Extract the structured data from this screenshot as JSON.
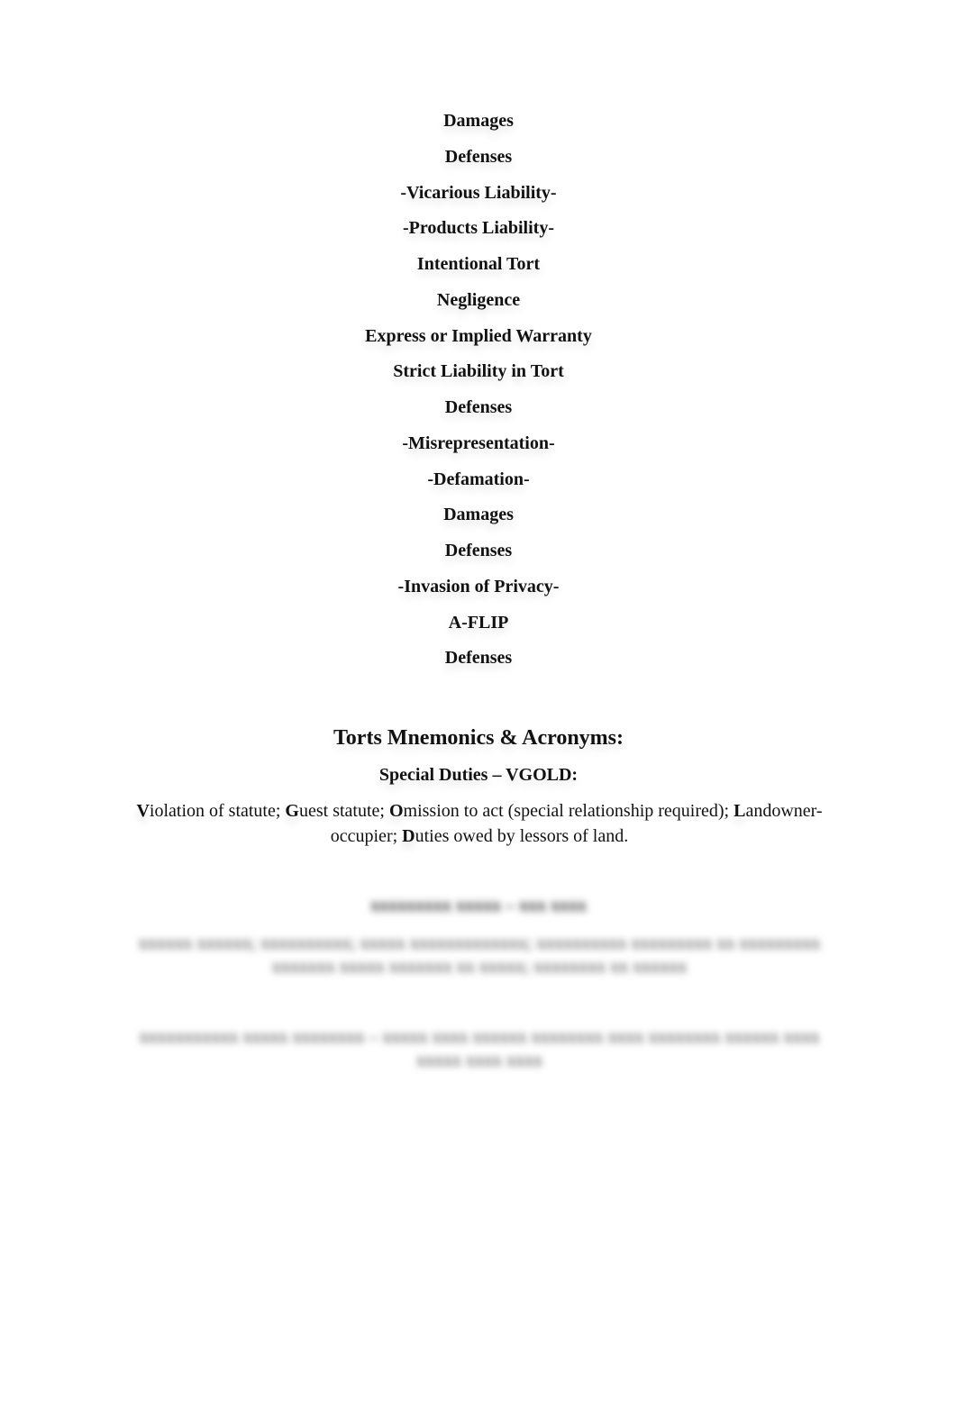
{
  "document": {
    "outline_headings": [
      "Damages",
      "Defenses",
      "-Vicarious Liability-",
      "-Products Liability-",
      "Intentional Tort",
      "Negligence",
      "Express or Implied Warranty",
      "Strict Liability in Tort",
      "Defenses",
      "-Misrepresentation-",
      "-Defamation-",
      "Damages",
      "Defenses",
      "-Invasion of Privacy-",
      "A-FLIP",
      "Defenses"
    ],
    "section_title": "Torts Mnemonics & Acronyms:",
    "special_duties": {
      "title": "Special Duties – VGOLD:",
      "segments": [
        {
          "key": "V",
          "rest": "iolation of statute; "
        },
        {
          "key": "G",
          "rest": "uest statute; "
        },
        {
          "key": "O",
          "rest": "mission to act (special relationship required); "
        },
        {
          "key": "L",
          "rest": "andowner-occupier; "
        },
        {
          "key": "D",
          "rest": "uties owed by lessors of land."
        }
      ]
    },
    "obscured_section": {
      "note": "content blurred / not legible in screenshot",
      "title_placeholder": "xxxxxxxxx xxxxx – xxx xxxx",
      "paragraph_1_placeholder": "xxxxxx xxxxxx; xxxxxxxxxx; xxxxx xxxxxxxxxxxxx; xxxxxxxxxx xxxxxxxxx xx xxxxxxxxx xxxxxxx xxxxx xxxxxxx xx xxxxx; xxxxxxxx xx xxxxxx",
      "paragraph_2_placeholder": "xxxxxxxxxxx xxxxx xxxxxxxx – xxxxx xxxx xxxxxx xxxxxxxx xxxx xxxxxxxx xxxxxx xxxx xxxxx xxxx xxxx"
    }
  }
}
